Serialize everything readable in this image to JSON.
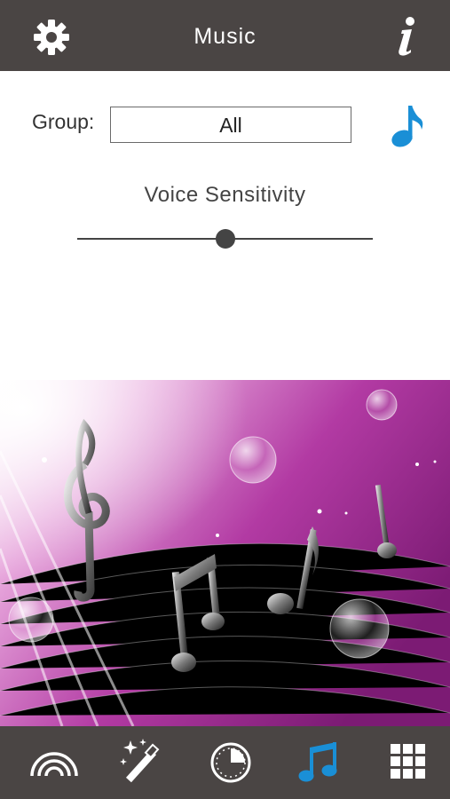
{
  "header": {
    "title": "Music",
    "settings_icon": "gear-icon",
    "info_icon": "info-icon"
  },
  "group": {
    "label": "Group:",
    "value": "All"
  },
  "music_button_icon": "music-note-icon",
  "voice_sensitivity": {
    "label": "Voice Sensitivity",
    "value": 0.5
  },
  "colors": {
    "bar": "#4a4544",
    "accent": "#1a8fd6",
    "art_purple": "#a0208f"
  },
  "tabs": [
    {
      "icon": "rainbow-icon",
      "active": false
    },
    {
      "icon": "magic-wand-icon",
      "active": false
    },
    {
      "icon": "timer-icon",
      "active": false
    },
    {
      "icon": "music-notes-icon",
      "active": true
    },
    {
      "icon": "grid-icon",
      "active": false
    }
  ]
}
